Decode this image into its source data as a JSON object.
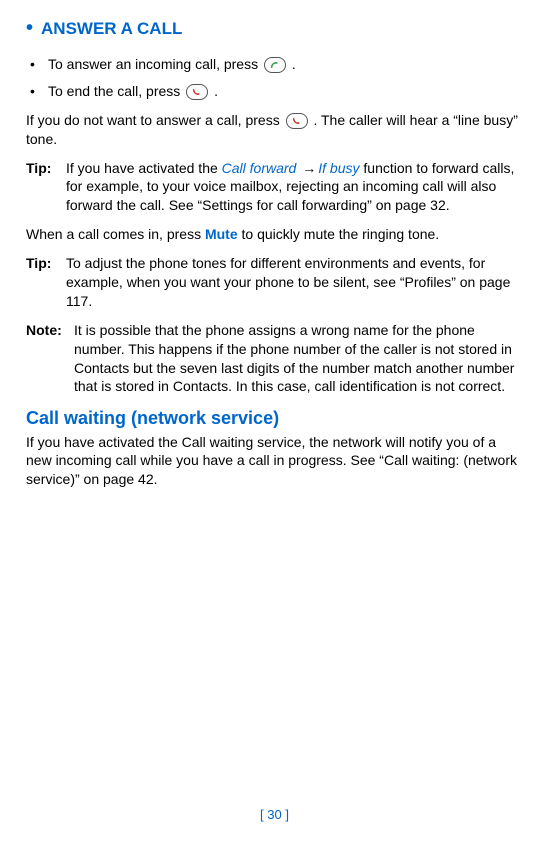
{
  "heading": "ANSWER A CALL",
  "bullets": [
    {
      "pre": "To answer an incoming call, press ",
      "post": "."
    },
    {
      "pre": "To end the call, press ",
      "post": "."
    }
  ],
  "reject": {
    "pre": "If you do not want to answer a call, press ",
    "post": ". The caller will hear a “line busy” tone."
  },
  "tip1": {
    "label": "Tip:",
    "pre": "If you have activated the ",
    "link1": "Call forward",
    "link2": "If busy",
    "post": " function to forward calls, for example, to your voice mailbox, rejecting an incoming call will also forward the call. See “Settings for call forwarding” on page 32."
  },
  "mutepara": {
    "pre": "When a call comes in, press ",
    "mute": "Mute",
    "post": " to quickly mute the ringing tone."
  },
  "tip2": {
    "label": "Tip:",
    "body": "To adjust the phone tones for different environments and events, for example, when you want your phone to be silent, see “Profiles” on page 117."
  },
  "note": {
    "label": "Note:",
    "body": "It is possible that the phone assigns a wrong name for the phone number. This happens if the phone number of the caller is not stored in Contacts but the seven last digits of the number match another number that is stored in Contacts. In this case, call identification is not correct."
  },
  "subheading": "Call waiting (network service)",
  "subbody": "If you have activated the Call waiting service, the network will notify you of a new incoming call while you have a call in progress. See “Call waiting: (network service)” on page 42.",
  "footer": "[ 30 ]"
}
